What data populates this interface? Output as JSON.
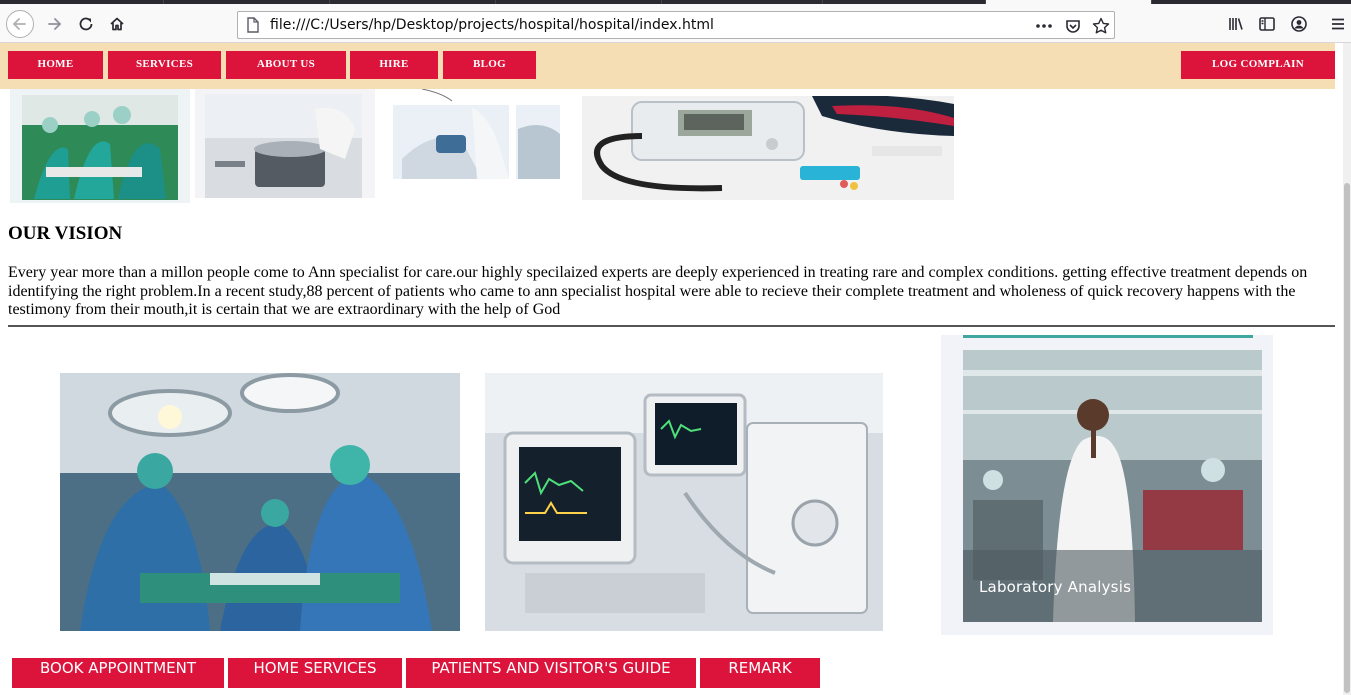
{
  "browser": {
    "url": "file:///C:/Users/hp/Desktop/projects/hospital/hospital/index.html"
  },
  "nav": {
    "home": "HOME",
    "services": "SERVICES",
    "about": "ABOUT US",
    "hire": "HIRE",
    "blog": "BLOG",
    "complain": "LOG COMPLAIN"
  },
  "vision": {
    "title": "OUR VISION",
    "text": "Every year more than a millon people come to Ann specialist for care.our highly specilaized experts are deeply experienced in treating rare and complex conditions. getting effective treatment depends on identifying the right problem.In a recent study,88 percent of patients who came to ann specialist hospital were able to recieve their complete treatment and wholeness of quick recovery happens with the testimony from their mouth,it is certain that we are extraordinary with the help of God"
  },
  "lab": {
    "caption": "Laboratory  Analysis"
  },
  "bottom_buttons": {
    "book": "BOOK APPOINTMENT",
    "home_services": "HOME SERVICES",
    "guide": "PATIENTS AND VISITOR'S GUIDE",
    "remark": "REMARK"
  },
  "colors": {
    "nav_bg": "#f5deb3",
    "accent": "#dc143c"
  }
}
